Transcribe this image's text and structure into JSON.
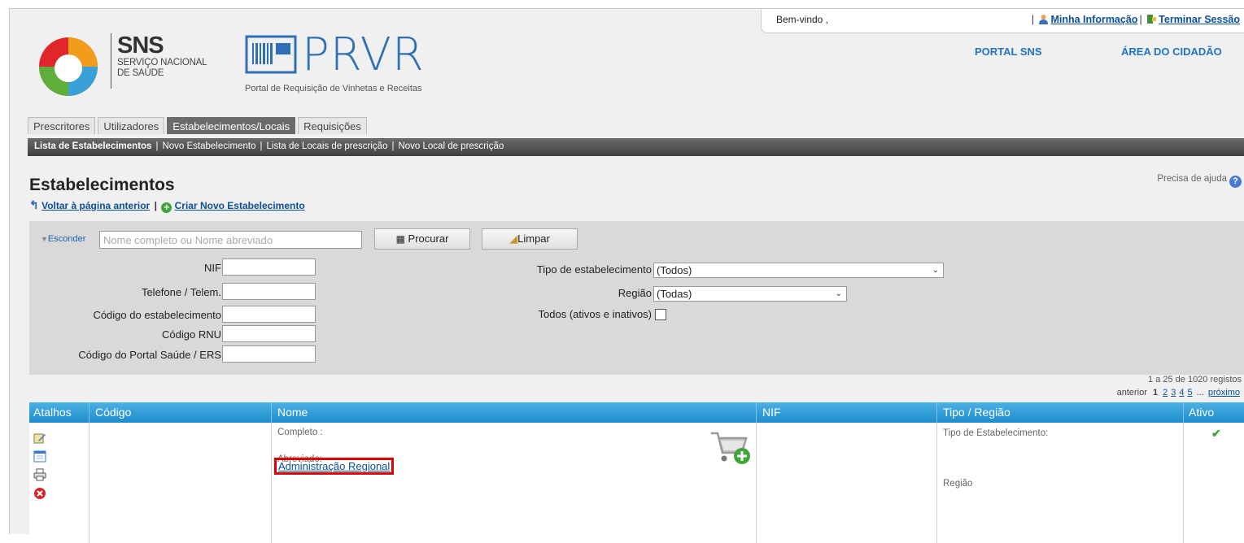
{
  "header": {
    "welcome": "Bem-vindo ,",
    "sep1": "|",
    "my_info": "Minha Informação",
    "sep2": "|",
    "logout": "Terminar Sessão",
    "portal_sns": "PORTAL SNS",
    "area_cidadao": "ÁREA DO CIDADÃO",
    "sns_big": "SNS",
    "sns_line1": "SERVIÇO NACIONAL",
    "sns_line2": "DE SAÚDE",
    "prvr_word": "PRVR",
    "prvr_sub": "Portal de Requisição de Vinhetas e Receitas"
  },
  "tabs": [
    {
      "label": "Prescritores",
      "active": false
    },
    {
      "label": "Utilizadores",
      "active": false
    },
    {
      "label": "Estabelecimentos/Locais",
      "active": true
    },
    {
      "label": "Requisições",
      "active": false
    }
  ],
  "subnav": {
    "item1": "Lista de Estabelecimentos",
    "item2": "Novo Estabelecimento",
    "item3": "Lista de Locais de prescrição",
    "item4": "Novo Local de prescrição",
    "sep": "|"
  },
  "page": {
    "title": "Estabelecimentos",
    "help": "Precisa de ajuda",
    "back": "Voltar à página anterior",
    "action_sep": "|",
    "create": "Criar Novo Estabelecimento"
  },
  "search": {
    "hide": "Esconder",
    "placeholder": "Nome completo ou Nome abreviado",
    "search_btn": "Procurar",
    "clear_btn": "Limpar",
    "fields": {
      "nif": "NIF",
      "telefone": "Telefone / Telem.",
      "codigo_est": "Código do estabelecimento",
      "codigo_rnu": "Código RNU",
      "codigo_portal": "Código do Portal Saúde / ERS",
      "tipo": "Tipo de estabelecimento",
      "tipo_value": "(Todos)",
      "regiao": "Região",
      "regiao_value": "(Todas)",
      "todos": "Todos (ativos e inativos)"
    }
  },
  "pagination": {
    "records": "1 a 25 de 1020 registos",
    "prev": "anterior",
    "current": "1",
    "pages": [
      "2",
      "3",
      "4",
      "5"
    ],
    "ellipsis": "...",
    "next": "próximo"
  },
  "table": {
    "headers": [
      "Atalhos",
      "Código",
      "Nome",
      "NIF",
      "Tipo / Região",
      "Ativo"
    ],
    "row": {
      "completo_label": "Completo :",
      "name_link": "Administração Regional",
      "abreviado_label": "Abreviado:",
      "tipo_label": "Tipo de Estabelecimento:",
      "regiao_label": "Região"
    }
  },
  "colors": {
    "accent_blue": "#1e8ccc",
    "link_blue": "#0b4f9a",
    "highlight_red": "#e00000",
    "active_green": "#3fa53a"
  }
}
